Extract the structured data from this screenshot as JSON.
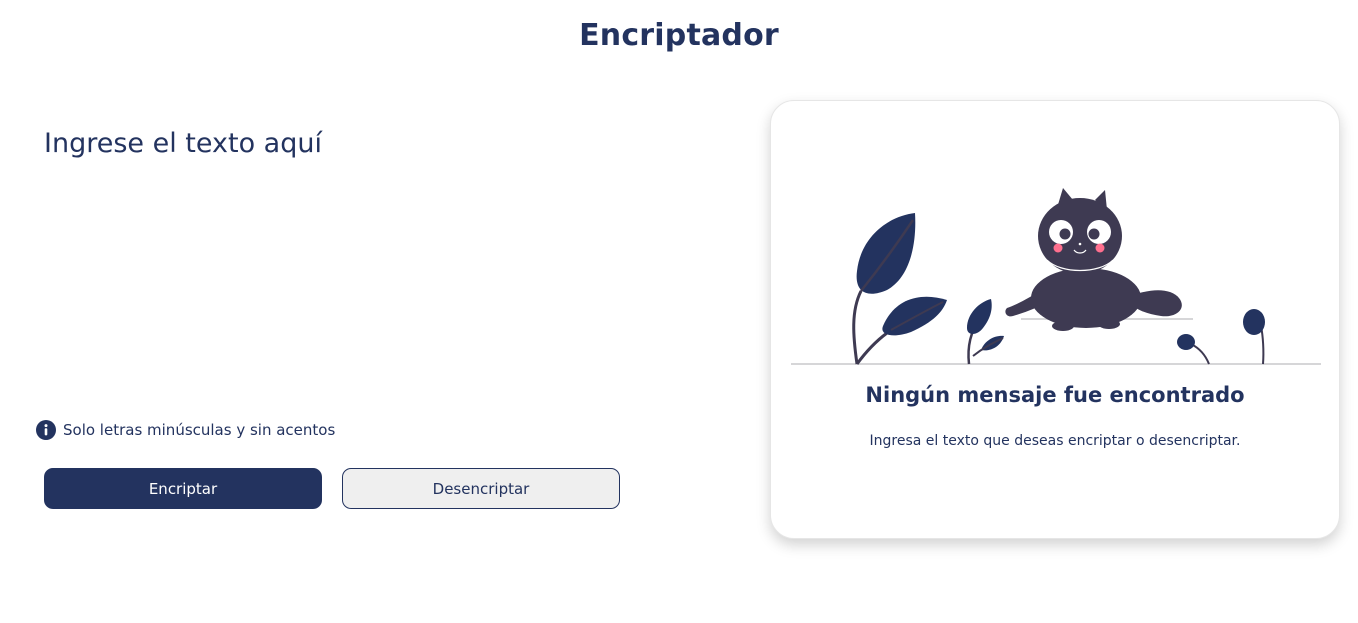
{
  "header": {
    "title": "Encriptador"
  },
  "input": {
    "placeholder": "Ingrese el texto aquí",
    "value": ""
  },
  "hint": {
    "icon": "info-icon",
    "text": "Solo letras minúsculas y sin acentos"
  },
  "actions": {
    "encrypt_label": "Encriptar",
    "decrypt_label": "Desencriptar"
  },
  "result_panel": {
    "illustration": "cat-with-plants-illustration",
    "title": "Ningún mensaje fue encontrado",
    "description": "Ingresa el texto que deseas encriptar o desencriptar."
  },
  "colors": {
    "primary": "#23335f",
    "secondary_button_bg": "#efefef",
    "cat": "#3e3a52",
    "cheeks": "#ff6f8e",
    "background": "#ffffff"
  }
}
